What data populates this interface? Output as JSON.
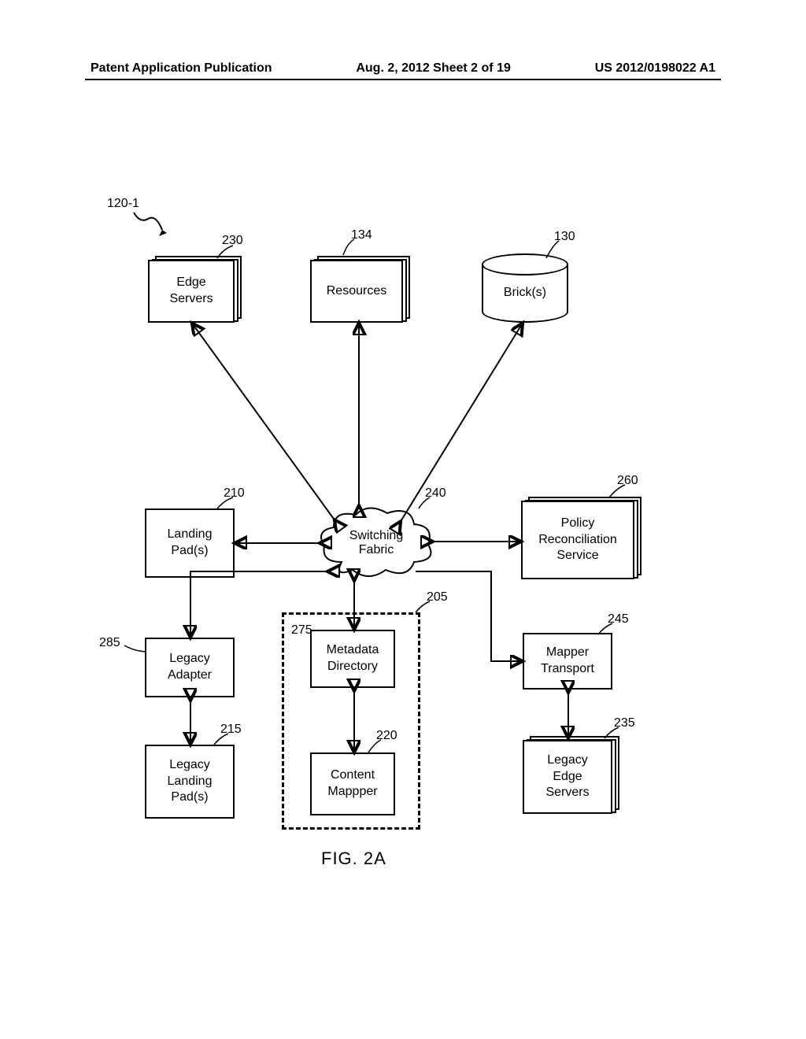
{
  "header": {
    "left": "Patent Application Publication",
    "center": "Aug. 2, 2012  Sheet 2 of 19",
    "right": "US 2012/0198022 A1"
  },
  "nodes": {
    "edge_servers": "Edge\nServers",
    "resources": "Resources",
    "bricks": "Brick(s)",
    "landing_pads": "Landing\nPad(s)",
    "switching_fabric": "Switching\nFabric",
    "policy_reconciliation": "Policy\nReconciliation\nService",
    "legacy_adapter": "Legacy\nAdapter",
    "metadata_directory": "Metadata\nDirectory",
    "mapper_transport": "Mapper\nTransport",
    "legacy_landing_pads": "Legacy\nLanding\nPad(s)",
    "content_mapper": "Content\nMappper",
    "legacy_edge_servers": "Legacy\nEdge\nServers"
  },
  "refs": {
    "r120_1": "120-1",
    "r230": "230",
    "r134": "134",
    "r130": "130",
    "r210": "210",
    "r240": "240",
    "r260": "260",
    "r205": "205",
    "r285": "285",
    "r275": "275",
    "r245": "245",
    "r215": "215",
    "r220": "220",
    "r235": "235"
  },
  "figure_caption": "FIG. 2A"
}
